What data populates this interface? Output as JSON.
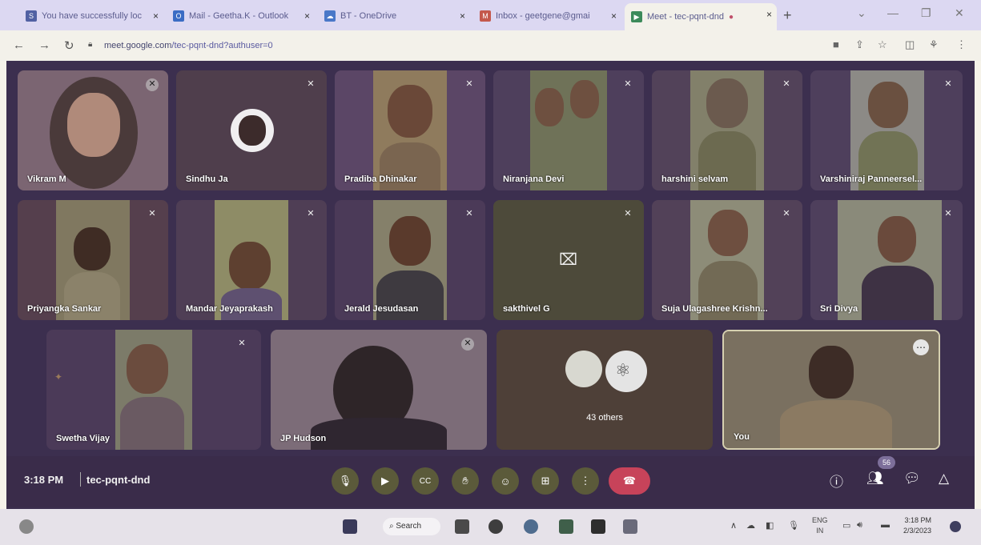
{
  "browser": {
    "tabs": [
      {
        "title": "You have successfully loc",
        "close": "×"
      },
      {
        "title": "Mail - Geetha.K - Outlook",
        "close": "×"
      },
      {
        "title": "BT - OneDrive",
        "close": "×"
      },
      {
        "title": "Inbox - geetgene@gmai",
        "close": "×"
      },
      {
        "title": "Meet - tec-pqnt-dnd",
        "close": "×"
      }
    ],
    "new_tab": "+",
    "url_domain": "meet.google.com",
    "url_path": "/tec-pqnt-dnd?authuser=0"
  },
  "meet": {
    "participants": [
      {
        "name": "Vikram M"
      },
      {
        "name": "Sindhu Ja"
      },
      {
        "name": "Pradiba Dhinakar"
      },
      {
        "name": "Niranjana Devi"
      },
      {
        "name": "harshini selvam"
      },
      {
        "name": "Varshiniraj Panneersel..."
      },
      {
        "name": "Priyangka Sankar"
      },
      {
        "name": "Mandar Jeyaprakash"
      },
      {
        "name": "Jerald Jesudasan"
      },
      {
        "name": "sakthivel G"
      },
      {
        "name": "Suja Ulagashree Krishn..."
      },
      {
        "name": "Sri Divya"
      },
      {
        "name": "Swetha Vijay"
      },
      {
        "name": "JP Hudson"
      },
      {
        "name": "You"
      }
    ],
    "others_label": "43 others",
    "time": "3:18 PM",
    "meeting_code": "tec-pqnt-dnd",
    "people_count": "56"
  },
  "taskbar": {
    "search_label": "Search",
    "lang_top": "ENG",
    "lang_bottom": "IN",
    "clock_time": "3:18 PM",
    "clock_date": "2/3/2023"
  }
}
